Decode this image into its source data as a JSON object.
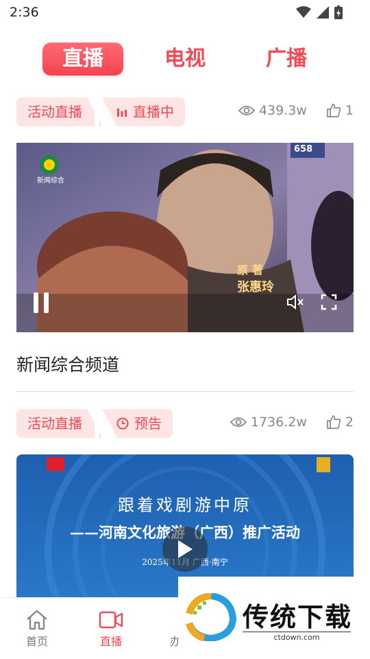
{
  "status": {
    "time": "2:36"
  },
  "tabs": [
    {
      "label": "直播",
      "active": true
    },
    {
      "label": "电视",
      "active": false
    },
    {
      "label": "广播",
      "active": false
    }
  ],
  "cards": [
    {
      "type_label": "活动直播",
      "status_label": "直播中",
      "status_icon": "bars-icon",
      "views": "439.3w",
      "likes": "1",
      "title": "新闻综合频道",
      "video": {
        "logo_text": "新闻综合",
        "caption_line1": "原 著",
        "caption_line2": "张惠玲",
        "door_number": "658"
      }
    },
    {
      "type_label": "活动直播",
      "status_label": "预告",
      "status_icon": "clock-icon",
      "views": "1736.2w",
      "likes": "2",
      "video": {
        "line1": "跟着戏剧游中原",
        "line2": "——河南文化旅游（广西）推广活动",
        "line3": "2025年11月 广西·南宁"
      }
    }
  ],
  "nav": [
    {
      "label": "首页",
      "icon": "home-icon",
      "active": false
    },
    {
      "label": "直播",
      "icon": "video-camera-icon",
      "active": true
    },
    {
      "label": "办",
      "icon": "bracket-icon",
      "active": false
    }
  ],
  "watermark": {
    "brand": "传统下载",
    "url": "ctdown.com"
  },
  "colors": {
    "accent": "#ee4a55",
    "badge_bg": "#fde4e5"
  }
}
